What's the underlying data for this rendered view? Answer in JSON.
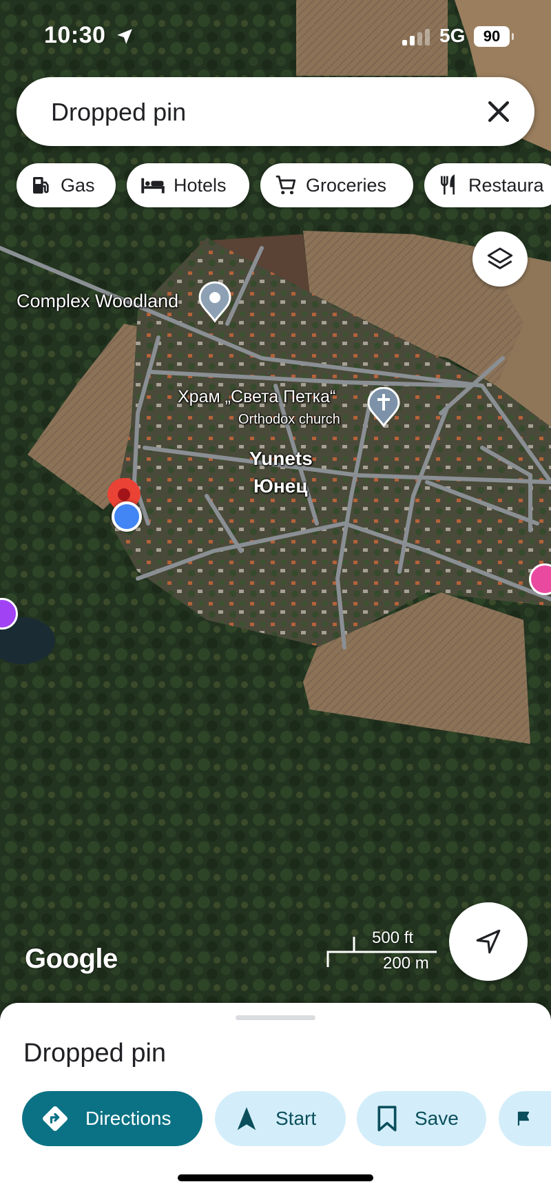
{
  "status_bar": {
    "time": "10:30",
    "network": "5G",
    "battery": "90"
  },
  "search": {
    "query": "Dropped pin"
  },
  "chips": [
    {
      "label": "Gas",
      "icon": "gas-station-icon"
    },
    {
      "label": "Hotels",
      "icon": "bed-icon"
    },
    {
      "label": "Groceries",
      "icon": "shopping-cart-icon"
    },
    {
      "label": "Restaura",
      "icon": "fork-knife-icon"
    }
  ],
  "map_labels": {
    "complex": "Complex Woodland",
    "church_name": "Храм „Света Петка“",
    "church_type": "Orthodox church",
    "town_latin": "Yunets",
    "town_cyrillic": "Юнец"
  },
  "scale": {
    "feet": "500 ft",
    "meters": "200 m"
  },
  "branding": {
    "logo": "Google"
  },
  "sheet": {
    "title": "Dropped pin",
    "actions": [
      {
        "label": "Directions",
        "icon": "directions-icon"
      },
      {
        "label": "Start",
        "icon": "navigation-arrow-icon"
      },
      {
        "label": "Save",
        "icon": "bookmark-icon"
      },
      {
        "label": "",
        "icon": "flag-icon"
      }
    ]
  },
  "colors": {
    "accent": "#0b7285",
    "secondary_button": "#d3eefa",
    "pin_red": "#ea4335",
    "location_blue": "#4285f4"
  }
}
